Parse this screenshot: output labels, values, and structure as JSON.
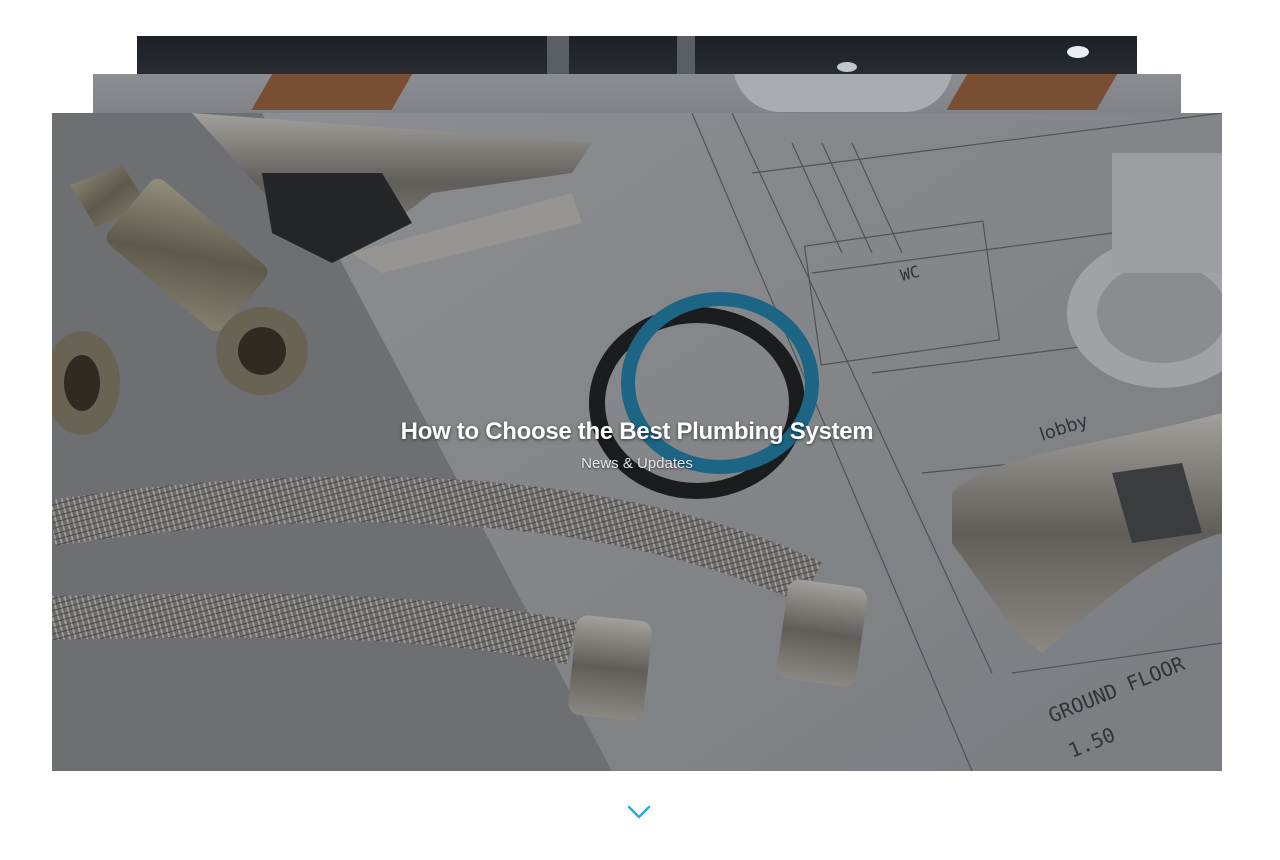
{
  "slider": {
    "active_slide": {
      "title": "How to Choose the Best Plumbing System",
      "category": "News & Updates"
    },
    "image_description_icon": "plumbing-tools-on-blueprint-image"
  },
  "navigation": {
    "scroll_down_icon": "chevron-down-icon"
  },
  "colors": {
    "accent": "#29a8e0",
    "overlay": "#141618",
    "background": "#ffffff"
  }
}
